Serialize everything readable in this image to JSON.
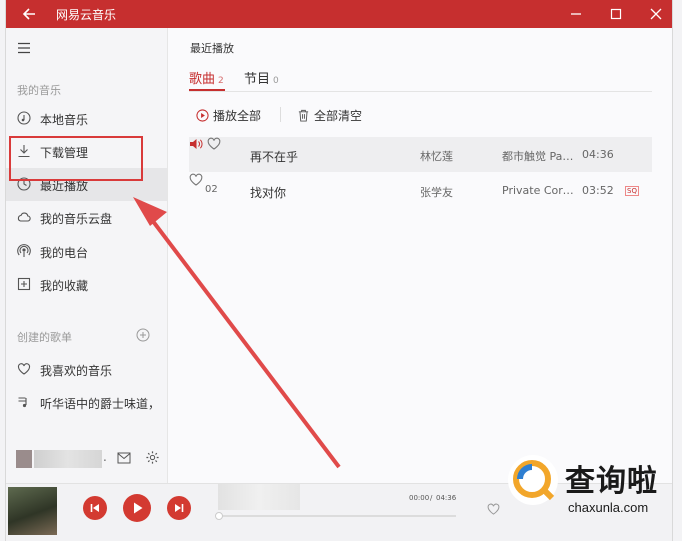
{
  "window": {
    "title": "网易云音乐"
  },
  "sidebar": {
    "section_my_music": "我的音乐",
    "items": [
      {
        "label": "本地音乐",
        "icon": "music-note-icon"
      },
      {
        "label": "下载管理",
        "icon": "download-icon"
      },
      {
        "label": "最近播放",
        "icon": "clock-icon",
        "active": true
      },
      {
        "label": "我的音乐云盘",
        "icon": "cloud-icon"
      },
      {
        "label": "我的电台",
        "icon": "radio-icon"
      },
      {
        "label": "我的收藏",
        "icon": "collection-icon"
      }
    ],
    "section_playlists": "创建的歌单",
    "playlists": [
      {
        "label": "我喜欢的音乐",
        "icon": "heart-icon"
      },
      {
        "label": "听华语中的爵士味道，",
        "icon": "playlist-icon"
      }
    ],
    "user_suffix": "."
  },
  "main": {
    "page_title": "最近播放",
    "tabs": [
      {
        "label": "歌曲",
        "count": "2"
      },
      {
        "label": "节目",
        "count": "0"
      }
    ],
    "actions": {
      "play_all": "播放全部",
      "clear_all": "全部清空"
    },
    "songs": [
      {
        "index": "",
        "title": "再不在乎",
        "artist": "林忆莲",
        "album": "都市触觉 Part...",
        "duration": "04:36",
        "badge": "",
        "playing": true
      },
      {
        "index": "02",
        "title": "找对你",
        "artist": "张学友",
        "album": "Private Corner",
        "duration": "03:52",
        "badge": "SQ",
        "playing": false
      }
    ]
  },
  "player": {
    "current_time": "00:00",
    "total_time": "04:36",
    "progress": 0.0
  },
  "watermark": {
    "text": "查询啦",
    "sub": "chaxunla.com"
  },
  "colors": {
    "accent": "#c62f2f",
    "annotation": "#d93a3a"
  }
}
